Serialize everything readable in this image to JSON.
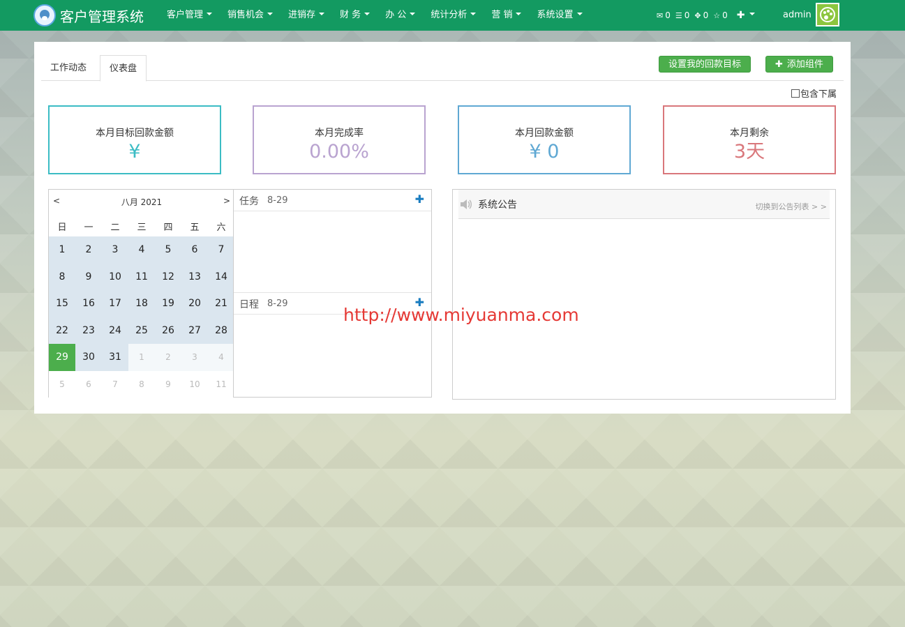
{
  "app": {
    "title": "客户管理系统"
  },
  "nav": {
    "items": [
      {
        "label": "客户管理"
      },
      {
        "label": "销售机会"
      },
      {
        "label": "进销存"
      },
      {
        "label": "财 务"
      },
      {
        "label": "办 公"
      },
      {
        "label": "统计分析"
      },
      {
        "label": "营 销"
      },
      {
        "label": "系统设置"
      }
    ],
    "counters": {
      "mail": "0",
      "list": "0",
      "tasks": "0",
      "star": "0"
    },
    "plus": "✚",
    "user": "admin"
  },
  "tabs": [
    {
      "label": "工作动态"
    },
    {
      "label": "仪表盘"
    }
  ],
  "buttons": {
    "set_target": "设置我的回款目标",
    "add_widget": "添加组件",
    "add_widget_icon": "✚"
  },
  "include_sub": {
    "label": "包含下属"
  },
  "stats": [
    {
      "label": "本月目标回款金额",
      "value": "¥",
      "color": "#3bbcc4"
    },
    {
      "label": "本月完成率",
      "value": "0.00%",
      "color": "#b9a3d0"
    },
    {
      "label": "本月回款金额",
      "value": "¥ 0",
      "color": "#5fa8d3"
    },
    {
      "label": "本月剩余",
      "value": "3天",
      "color": "#d9777b"
    }
  ],
  "calendar": {
    "prev": "<",
    "next": ">",
    "title": "八月 2021",
    "weekdays": [
      "日",
      "一",
      "二",
      "三",
      "四",
      "五",
      "六"
    ],
    "weeks": [
      [
        "1",
        "2",
        "3",
        "4",
        "5",
        "6",
        "7"
      ],
      [
        "8",
        "9",
        "10",
        "11",
        "12",
        "13",
        "14"
      ],
      [
        "15",
        "16",
        "17",
        "18",
        "19",
        "20",
        "21"
      ],
      [
        "22",
        "23",
        "24",
        "25",
        "26",
        "27",
        "28"
      ],
      [
        "29",
        "30",
        "31",
        "1",
        "2",
        "3",
        "4"
      ],
      [
        "5",
        "6",
        "7",
        "8",
        "9",
        "10",
        "11"
      ]
    ],
    "today": "29"
  },
  "task_section": {
    "title": "任务",
    "date": "8-29",
    "plus": "✚"
  },
  "schedule_section": {
    "title": "日程",
    "date": "8-29",
    "plus": "✚"
  },
  "notice": {
    "title": "系统公告",
    "link": "切换到公告列表 > >"
  },
  "watermark": "http://www.miyuanma.com",
  "colors": {
    "navbar": "#139a61",
    "button": "#4cae4c",
    "today": "#4cae4c"
  }
}
